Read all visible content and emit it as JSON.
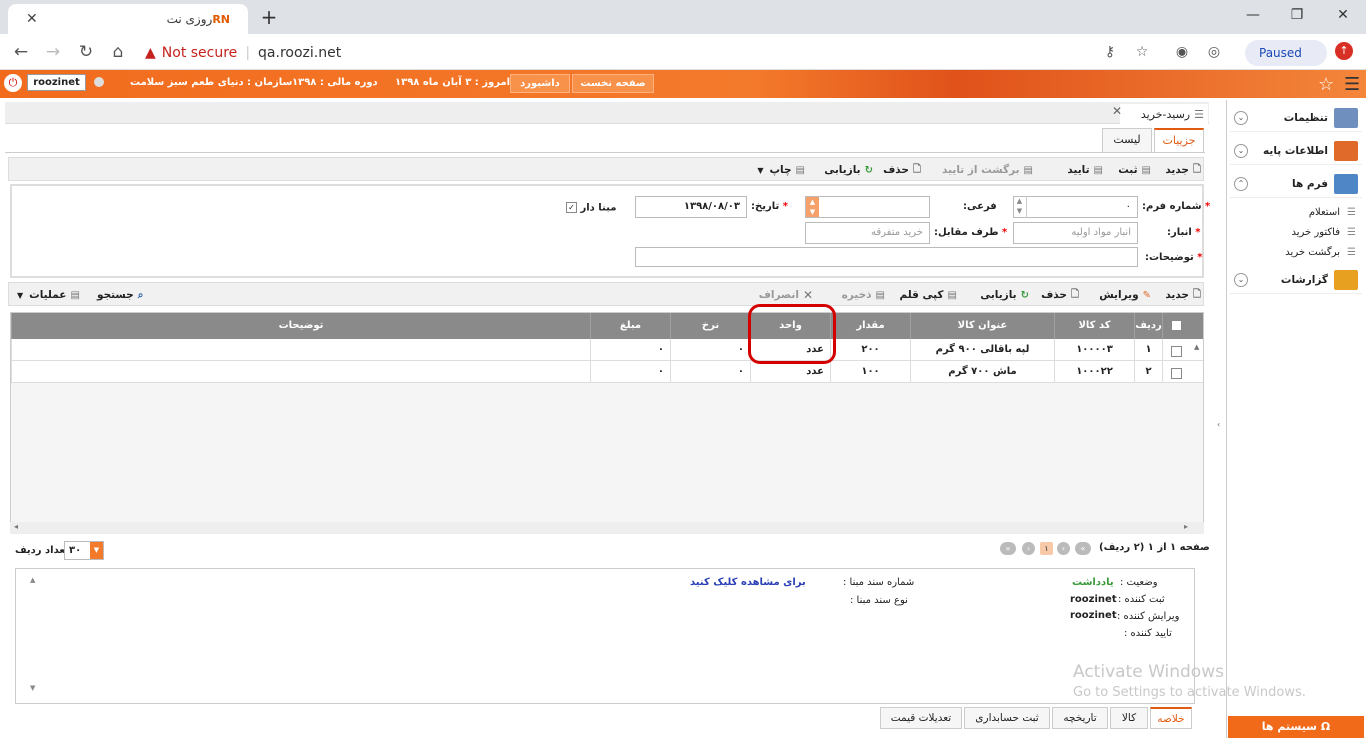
{
  "browser": {
    "tab_title": "روزی نت",
    "tab_favicon": "RN",
    "security_label": "Not secure",
    "url": "qa.roozi.net",
    "paused_label": "Paused"
  },
  "appbar": {
    "username": "roozinet",
    "org": "سازمان : دنیای طعم سبز سلامت",
    "fiscal_period": "دوره مالی : ۱۳۹۸",
    "today": "امروز : ۳ آبان ماه ۱۳۹۸",
    "dashboard": "داشبورد",
    "first_page": "صفحه نخست"
  },
  "sidebar": {
    "items": [
      {
        "label": "تنظیمات",
        "icon": "settings-icon",
        "color": "#6f8fbf"
      },
      {
        "label": "اطلاعات پایه",
        "icon": "pencil-icon",
        "color": "#e06a2a"
      },
      {
        "label": "فرم ها",
        "icon": "table-icon",
        "color": "#4f86c6"
      },
      {
        "label": "گزارشات",
        "icon": "report-icon",
        "color": "#e8a020"
      }
    ],
    "sub_items": [
      "استعلام",
      "فاکتور خرید",
      "برگشت خرید"
    ],
    "systems_button": "سیستم ها"
  },
  "page": {
    "breadcrumb": "رسید-خرید",
    "tabs": [
      "جزییات",
      "لیست"
    ]
  },
  "main_toolbar": {
    "new": "جدید",
    "register": "ثبت",
    "confirm": "تایید",
    "unconfirm": "برگشت از تایید",
    "delete": "حذف",
    "refresh": "بازیابی",
    "print": "چاپ"
  },
  "form": {
    "form_number_label": "شماره فرم:",
    "form_number_value": "۰",
    "sub_label": "فرعی:",
    "date_label": "تاریخ:",
    "date_value": "۱۳۹۸/۰۸/۰۳",
    "base_checkbox_label": "مبنا دار",
    "warehouse_label": "انبار:",
    "warehouse_value": "انبار مواد اولیه",
    "counterparty_label": "طرف مقابل:",
    "counterparty_value": "خرید متفرقه",
    "description_label": "توضیحات:"
  },
  "grid_toolbar": {
    "new": "جدید",
    "edit": "ویرایش",
    "delete": "حذف",
    "refresh": "بازیابی",
    "copy": "کپی قلم",
    "save": "ذخیره",
    "cancel": "انصراف",
    "search": "جستجو",
    "operations": "عملیات"
  },
  "grid": {
    "columns": [
      "ردیف",
      "کد کالا",
      "عنوان کالا",
      "مقدار",
      "واحد",
      "نرخ",
      "مبلغ",
      "توضیحات"
    ],
    "rows": [
      {
        "row": "۱",
        "code": "۱۰۰۰۰۳",
        "title": "لپه باقالی ۹۰۰ گرم",
        "qty": "۲۰۰",
        "unit": "عدد",
        "rate": "۰",
        "amount": "۰",
        "desc": ""
      },
      {
        "row": "۲",
        "code": "۱۰۰۰۲۲",
        "title": "ماش ۷۰۰ گرم",
        "qty": "۱۰۰",
        "unit": "عدد",
        "rate": "۰",
        "amount": "۰",
        "desc": ""
      }
    ]
  },
  "pager": {
    "summary": "صفحه ۱ از ۱ (۲ ردیف)",
    "current_page": "۱",
    "rows_per_page_label": "تعداد ردیف",
    "rows_per_page_value": "۳۰"
  },
  "info": {
    "status_label": "وضعیت :",
    "status_value": "یادداشت",
    "creator_label": "ثبت کننده :",
    "creator_value": "roozinet",
    "editor_label": "ویرایش کننده :",
    "editor_value": "roozinet",
    "approver_label": "تایید کننده :",
    "base_doc_label": "شماره سند مبنا :",
    "base_doc_link": "برای مشاهده کلیک کنید",
    "base_doc_type_label": "نوع سند مبنا :"
  },
  "bottom_tabs": [
    "خلاصه",
    "کالا",
    "تاریخچه",
    "ثبت حسابداری",
    "تعدیلات قیمت"
  ],
  "watermark": {
    "line1": "Activate Windows",
    "line2": "Go to Settings to activate Windows."
  }
}
